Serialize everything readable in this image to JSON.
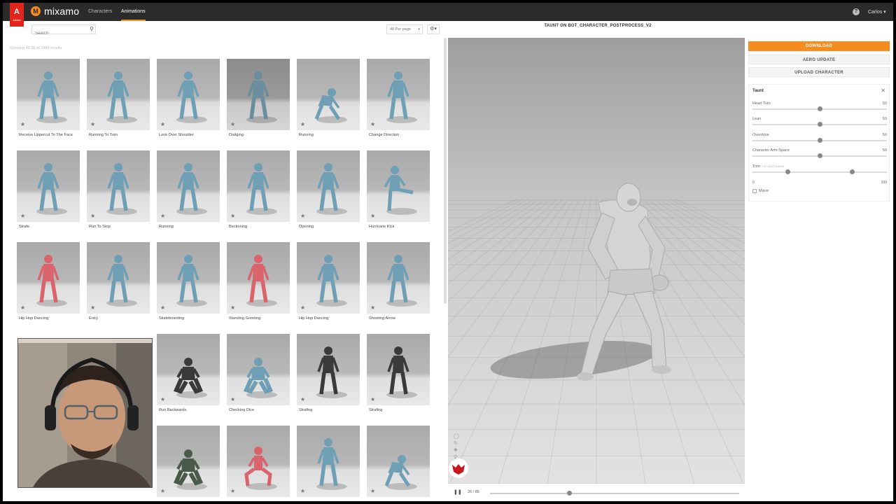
{
  "header": {
    "adobe_label": "A",
    "adobe_sub": "Adobe",
    "logo_text": "mixamo",
    "tabs": [
      {
        "label": "Characters",
        "active": false
      },
      {
        "label": "Animations",
        "active": true
      }
    ],
    "help": "?",
    "user": "Carlos ▾"
  },
  "browser": {
    "search_placeholder": "Search",
    "per_page": "48 Per page",
    "results_text": "Showing 49-96 of 2484 results",
    "cards": [
      {
        "label": "Receive Uppercut To The Face",
        "tint": "#6f9fb4"
      },
      {
        "label": "Running To Turn",
        "tint": "#6f9fb4"
      },
      {
        "label": "Look Over Shoulder",
        "tint": "#6f9fb4"
      },
      {
        "label": "Dodging",
        "tint": "#6a8e9e",
        "hover": true
      },
      {
        "label": "Running",
        "tint": "#6f9fb4",
        "pose": "low"
      },
      {
        "label": "Change Direction",
        "tint": "#6f9fb4"
      },
      {
        "label": "Strafe",
        "tint": "#6f9fb4"
      },
      {
        "label": "Run To Stop",
        "tint": "#6f9fb4"
      },
      {
        "label": "Running",
        "tint": "#6f9fb4"
      },
      {
        "label": "Beckoning",
        "tint": "#6f9fb4"
      },
      {
        "label": "Opening",
        "tint": "#6f9fb4"
      },
      {
        "label": "Hurricane Kick",
        "tint": "#6f9fb4",
        "pose": "kick"
      },
      {
        "label": "Hip Hop Dancing",
        "tint": "#d9646b"
      },
      {
        "label": "Entry",
        "tint": "#6f9fb4"
      },
      {
        "label": "Skateboarding",
        "tint": "#6f9fb4"
      },
      {
        "label": "Standing Greeting",
        "tint": "#d9646b"
      },
      {
        "label": "Hip Hop Dancing",
        "tint": "#6f9fb4"
      },
      {
        "label": "Shooting Arrow",
        "tint": "#6f9fb4"
      },
      {
        "label": "",
        "tint": "#6f9fb4",
        "hidden": true
      },
      {
        "label": "",
        "tint": "#6f9fb4",
        "hidden": true
      },
      {
        "label": "Run Backwards",
        "tint": "#3a3a3a",
        "pose": "crouch"
      },
      {
        "label": "Checking Dice",
        "tint": "#6f9fb4",
        "pose": "crouch"
      },
      {
        "label": "Strafing",
        "tint": "#3a3a3a"
      },
      {
        "label": "Strafing",
        "tint": "#3a3a3a"
      },
      {
        "label": "",
        "tint": "#6f9fb4",
        "hidden": true
      },
      {
        "label": "",
        "tint": "#6f9fb4",
        "hidden": true
      },
      {
        "label": "",
        "tint": "#4a5a4a",
        "pose": "crouch"
      },
      {
        "label": "",
        "tint": "#d9646b",
        "pose": "sit"
      },
      {
        "label": "",
        "tint": "#6f9fb4"
      },
      {
        "label": "",
        "tint": "#6f9fb4",
        "pose": "low"
      }
    ]
  },
  "viewport": {
    "title": "TAUNT ON BOT_CHARACTER_POSTPROCESS_V2",
    "frame_counter": "26 / 85",
    "progress": 0.31
  },
  "actions": {
    "download": "DOWNLOAD",
    "aero_update": "AERO UPDATE",
    "upload": "UPLOAD CHARACTER"
  },
  "settings": {
    "title": "Taunt",
    "sliders": [
      {
        "label": "Head Turn",
        "value": "50",
        "position": 0.5
      },
      {
        "label": "Lean",
        "value": "50",
        "position": 0.5
      },
      {
        "label": "Overdrive",
        "value": "50",
        "position": 0.5
      },
      {
        "label": "Character Arm-Space",
        "value": "50",
        "position": 0.5
      }
    ],
    "trim": {
      "label": "Trim",
      "sub": "As total Frames",
      "start": 0.26,
      "end": 0.74,
      "min_label": "0",
      "max_label": "100"
    },
    "mirror_label": "Mirror"
  },
  "colors": {
    "accent": "#f68b1f",
    "topbar": "#2b2b2b",
    "brand_red": "#e1251b"
  }
}
